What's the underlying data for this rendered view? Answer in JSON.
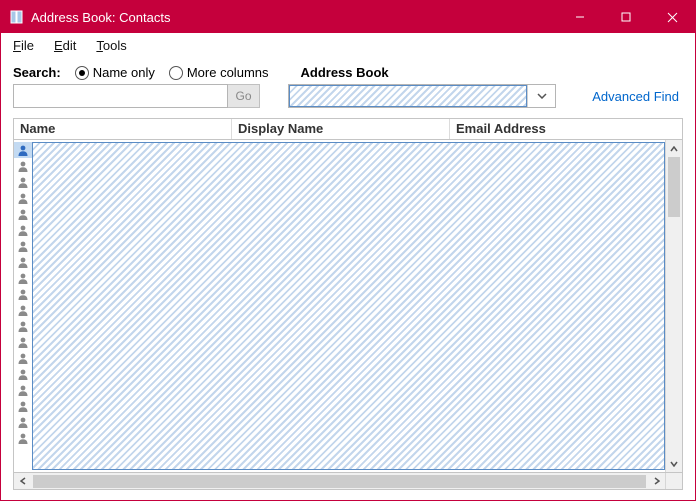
{
  "titlebar": {
    "title": "Address Book: Contacts"
  },
  "menubar": {
    "file_prefix": "F",
    "file_rest": "ile",
    "edit_prefix": "E",
    "edit_rest": "dit",
    "tools_prefix": "T",
    "tools_rest": "ools"
  },
  "search": {
    "label": "Search:",
    "name_only_prefix": "N",
    "name_only_rest": "ame only",
    "more_prefix": "More col",
    "more_underline": "u",
    "more_rest": "mns",
    "address_book_label": "Address Book",
    "go_label": "Go",
    "advanced_find": "Advanced Find"
  },
  "grid": {
    "col_name": "Name",
    "col_display": "Display Name",
    "col_email": "Email Address"
  }
}
